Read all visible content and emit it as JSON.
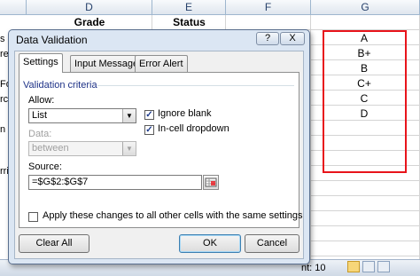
{
  "sheet": {
    "columns": [
      "D",
      "E",
      "F",
      "G"
    ],
    "header_row": {
      "grade": "Grade",
      "status": "Status"
    },
    "g_values": [
      "A",
      "B+",
      "B",
      "C+",
      "C",
      "D"
    ],
    "left_fragments": [
      "s",
      "re",
      "",
      "Fo",
      "rc",
      "",
      "n",
      "",
      "rri"
    ],
    "status_count": "nt: 10"
  },
  "dialog": {
    "title": "Data Validation",
    "help_label": "?",
    "close_label": "X",
    "tabs": [
      "Settings",
      "Input Message",
      "Error Alert"
    ],
    "group_label": "Validation criteria",
    "allow_label": "Allow:",
    "allow_value": "List",
    "ignore_blank_label": "Ignore blank",
    "ignore_blank_checked": true,
    "incell_dropdown_label": "In-cell dropdown",
    "incell_dropdown_checked": true,
    "data_label": "Data:",
    "data_value": "between",
    "source_label": "Source:",
    "source_value": "=$G$2:$G$7",
    "apply_label": "Apply these changes to all other cells with the same settings",
    "clear_all_label": "Clear All",
    "ok_label": "OK",
    "cancel_label": "Cancel"
  },
  "colors": {
    "highlight_border": "#e8141b",
    "dialog_frame": "#dbe6f3",
    "group_label": "#1e3287"
  }
}
